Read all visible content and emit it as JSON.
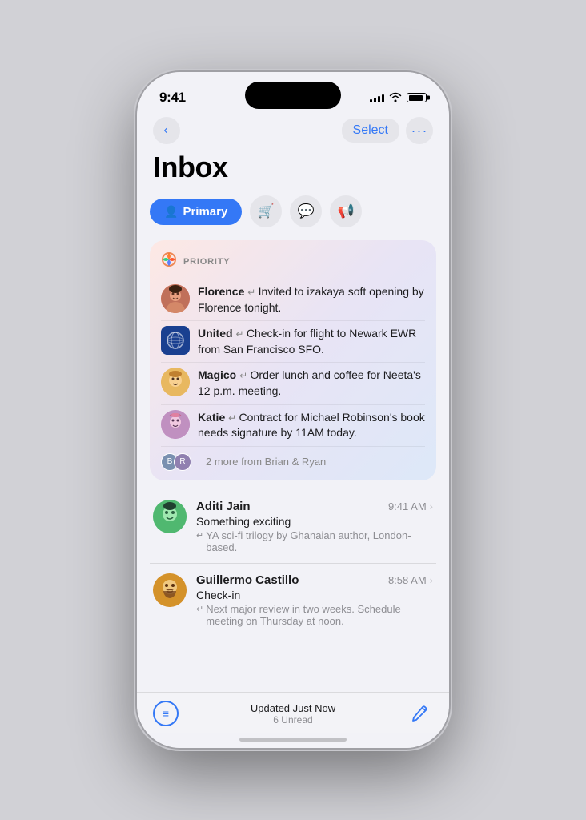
{
  "statusBar": {
    "time": "9:41",
    "signalBars": [
      4,
      6,
      8,
      10,
      12
    ],
    "batteryPercent": 85
  },
  "nav": {
    "backLabel": "‹",
    "selectLabel": "Select",
    "moreLabel": "•••"
  },
  "header": {
    "title": "Inbox"
  },
  "tabs": [
    {
      "id": "primary",
      "label": "Primary",
      "icon": "👤",
      "active": true
    },
    {
      "id": "shopping",
      "label": "",
      "icon": "🛒",
      "active": false
    },
    {
      "id": "messages",
      "label": "",
      "icon": "💬",
      "active": false
    },
    {
      "id": "promotions",
      "label": "",
      "icon": "📢",
      "active": false
    }
  ],
  "priority": {
    "label": "PRIORITY",
    "icon": "🔮",
    "items": [
      {
        "sender": "Florence",
        "snippet": "Invited to izakaya soft opening by Florence tonight.",
        "avatarType": "florence"
      },
      {
        "sender": "United",
        "snippet": "Check-in for flight to Newark EWR from San Francisco SFO.",
        "avatarType": "united"
      },
      {
        "sender": "Magico",
        "snippet": "Order lunch and coffee for Neeta's 12 p.m. meeting.",
        "avatarType": "magico"
      },
      {
        "sender": "Katie",
        "snippet": "Contract for Michael Robinson's book needs signature by 11AM today.",
        "avatarType": "katie"
      }
    ],
    "moreText": "2 more from Brian & Ryan",
    "moreAvatars": [
      "B",
      "R"
    ]
  },
  "emails": [
    {
      "sender": "Aditi Jain",
      "time": "9:41 AM",
      "subject": "Something exciting",
      "snippet": "YA sci-fi trilogy by Ghanaian author, London-based.",
      "avatarType": "aditi"
    },
    {
      "sender": "Guillermo Castillo",
      "time": "8:58 AM",
      "subject": "Check-in",
      "snippet": "Next major review in two weeks. Schedule meeting on Thursday at noon.",
      "avatarType": "guillermo"
    }
  ],
  "bottomBar": {
    "statusTitle": "Updated Just Now",
    "statusSub": "6 Unread",
    "listIcon": "≡",
    "composeIcon": "✏"
  }
}
